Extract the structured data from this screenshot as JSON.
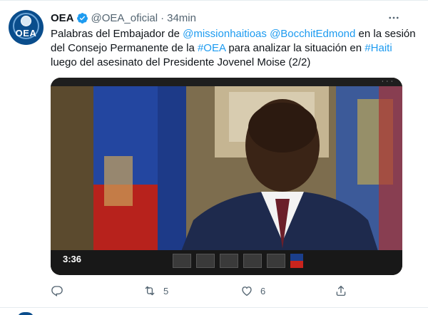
{
  "tweet": {
    "avatar": {
      "logo_text": "OEA",
      "logo_subtitle": ""
    },
    "author_name": "OEA",
    "handle": "@OEA_oficial",
    "separator": "·",
    "timestamp": "34min",
    "more_icon": "more-horizontal-icon",
    "verified_icon": "verified-badge-icon",
    "text_segments": [
      {
        "text": "Palabras del Embajador de ",
        "link": false
      },
      {
        "text": "@missionhaitioas",
        "link": true
      },
      {
        "text": " ",
        "link": false
      },
      {
        "text": "@BocchitEdmond",
        "link": true
      },
      {
        "text": " en la sesión del Consejo Permanente de la ",
        "link": false
      },
      {
        "text": "#OEA",
        "link": true
      },
      {
        "text": " para analizar la situación en ",
        "link": false
      },
      {
        "text": "#Haiti",
        "link": true
      },
      {
        "text": " luego del asesinato del Presidente Jovenel Moise (2/2)",
        "link": false
      }
    ],
    "video": {
      "timecode": "3:36",
      "top_left_label": "",
      "thumbnails": [
        {
          "label": ""
        },
        {
          "label": ""
        },
        {
          "label": ""
        },
        {
          "label": ""
        },
        {
          "label": ""
        }
      ]
    },
    "actions": {
      "reply": {
        "icon": "reply-icon",
        "count": ""
      },
      "retweet": {
        "icon": "retweet-icon",
        "count": "5"
      },
      "like": {
        "icon": "heart-icon",
        "count": "6"
      },
      "share": {
        "icon": "share-icon",
        "count": ""
      }
    },
    "colors": {
      "link": "#1d9bf0",
      "secondary_text": "#536471",
      "verified": "#1d9bf0",
      "logo_blue": "#0a4d8c"
    }
  }
}
